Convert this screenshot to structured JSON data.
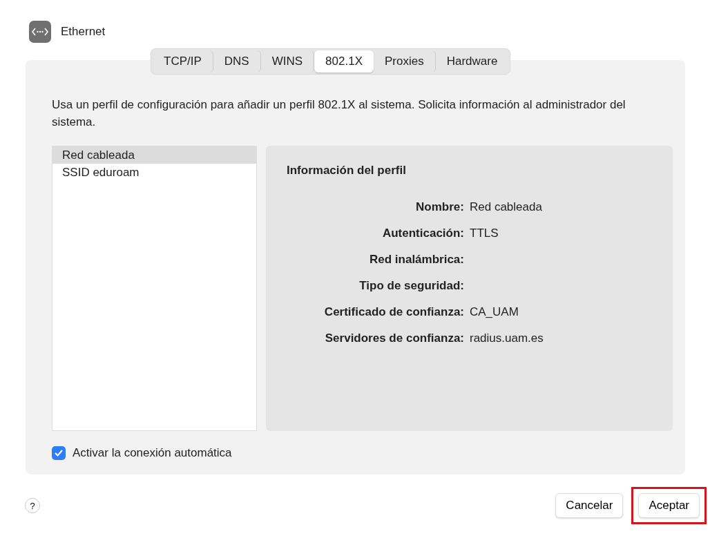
{
  "window": {
    "title": "Ethernet"
  },
  "tabs": [
    {
      "label": "TCP/IP",
      "selected": false
    },
    {
      "label": "DNS",
      "selected": false
    },
    {
      "label": "WINS",
      "selected": false
    },
    {
      "label": "802.1X",
      "selected": true
    },
    {
      "label": "Proxies",
      "selected": false
    },
    {
      "label": "Hardware",
      "selected": false
    }
  ],
  "description": "Usa un perfil de configuración para añadir un perfil 802.1X al sistema. Solicita información al administrador del sistema.",
  "profiles": [
    {
      "label": "Red cableada",
      "selected": true
    },
    {
      "label": "SSID eduroam",
      "selected": false
    }
  ],
  "profile_info": {
    "title": "Información del perfil",
    "fields": [
      {
        "label": "Nombre:",
        "value": "Red cableada"
      },
      {
        "label": "Autenticación:",
        "value": "TTLS"
      },
      {
        "label": "Red inalámbrica:"
      },
      {
        "label": "Tipo de seguridad:"
      },
      {
        "label": "Certificado de confianza:",
        "value": "CA_UAM"
      },
      {
        "label": "Servidores de confianza:",
        "value": "radius.uam.es"
      }
    ]
  },
  "auto_connect": {
    "label": "Activar la conexión automática",
    "checked": true
  },
  "help": {
    "label": "?"
  },
  "buttons": [
    {
      "label": "Cancelar",
      "highlighted": false
    },
    {
      "label": "Aceptar",
      "highlighted": true
    }
  ]
}
